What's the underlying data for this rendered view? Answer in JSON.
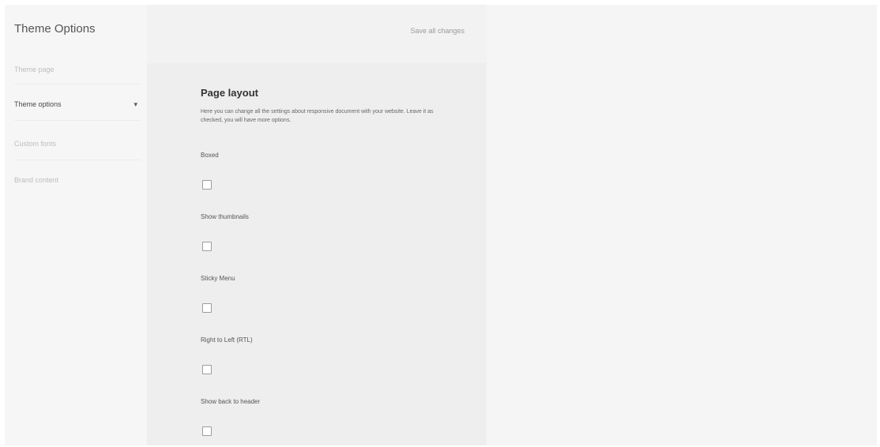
{
  "sidebar": {
    "title": "Theme Options",
    "items": [
      {
        "label": "Theme page",
        "active": false
      },
      {
        "label": "Theme options",
        "active": true
      },
      {
        "label": "Custom fonts",
        "active": false
      },
      {
        "label": "Brand content",
        "active": false
      }
    ],
    "chevron": "▾"
  },
  "toolbar": {
    "save_label": "Save all changes"
  },
  "section": {
    "title": "Page layout",
    "description": "Here you can change all the settings about responsive document with your website. Leave it as checked, you will have more options.",
    "options": [
      {
        "label": "Boxed",
        "checked": false
      },
      {
        "label": "Show thumbnails",
        "checked": false
      },
      {
        "label": "Sticky Menu",
        "checked": false
      },
      {
        "label": "Right to Left (RTL)",
        "checked": false
      },
      {
        "label": "Show back to header",
        "checked": false
      }
    ]
  }
}
